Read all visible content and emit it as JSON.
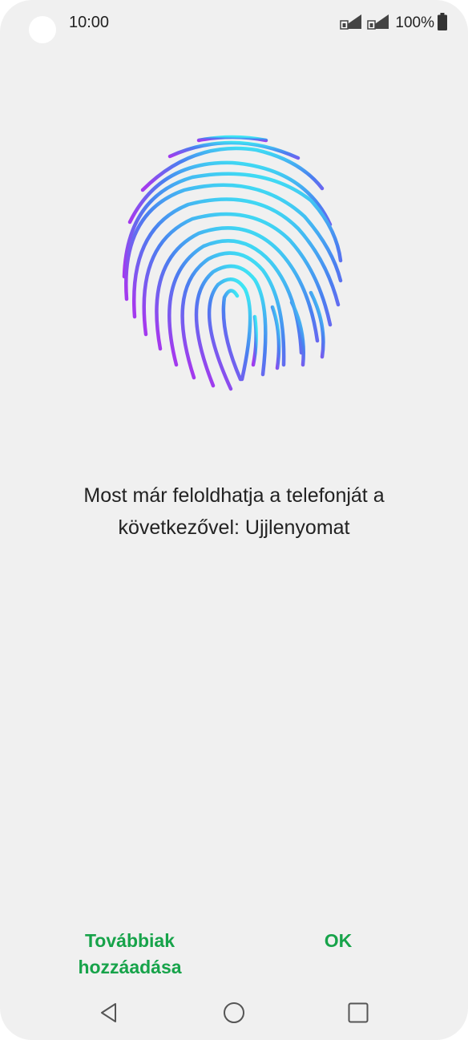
{
  "status_bar": {
    "time": "10:00",
    "battery": "100%",
    "icons": [
      "sim1-signal-icon",
      "sim2-signal-icon",
      "battery-icon"
    ]
  },
  "main": {
    "message": "Most már feloldhatja a telefonját a következővel: Ujjlenyomat",
    "graphic": "fingerprint-icon"
  },
  "actions": {
    "add_more": "Továbbiak hozzáadása",
    "ok": "OK"
  },
  "nav": {
    "icons": [
      "back-icon",
      "home-icon",
      "recents-icon"
    ]
  },
  "colors": {
    "accent": "#17a34a",
    "background": "#f0f0f0",
    "fingerprint_top": "#3ee6f4",
    "fingerprint_mid": "#4a7ff0",
    "fingerprint_bottom": "#a33aee"
  }
}
